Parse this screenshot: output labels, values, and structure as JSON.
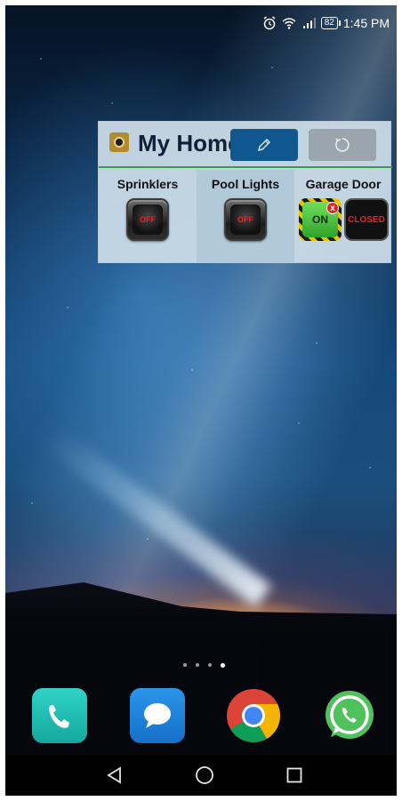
{
  "status_bar": {
    "time": "1:45 PM",
    "battery": "82",
    "icons": [
      "alarm-icon",
      "wifi-icon",
      "signal-icon",
      "battery-icon"
    ]
  },
  "widget": {
    "title": "My Home",
    "edit_icon": "pencil-icon",
    "refresh_icon": "refresh-icon",
    "tiles": [
      {
        "label": "Sprinklers",
        "state": "OFF"
      },
      {
        "label": "Pool Lights",
        "state": "OFF"
      },
      {
        "label": "Garage Door",
        "state_on": "ON",
        "state_closed": "CLOSED",
        "error": "x"
      }
    ]
  },
  "home_screen": {
    "page_count": 4,
    "active_page": 4
  },
  "dock": {
    "apps": [
      "phone-app",
      "messages-app",
      "chrome-app",
      "whatsapp-app"
    ]
  },
  "nav_bar": {
    "buttons": [
      "back-button",
      "home-button",
      "recent-apps-button"
    ]
  },
  "colors": {
    "edit_button": "#11578f",
    "refresh_button": "#9aa5ad",
    "header_divider": "#3a9a4f",
    "off_text": "#e0262b",
    "on_green": "#2fa32a"
  }
}
